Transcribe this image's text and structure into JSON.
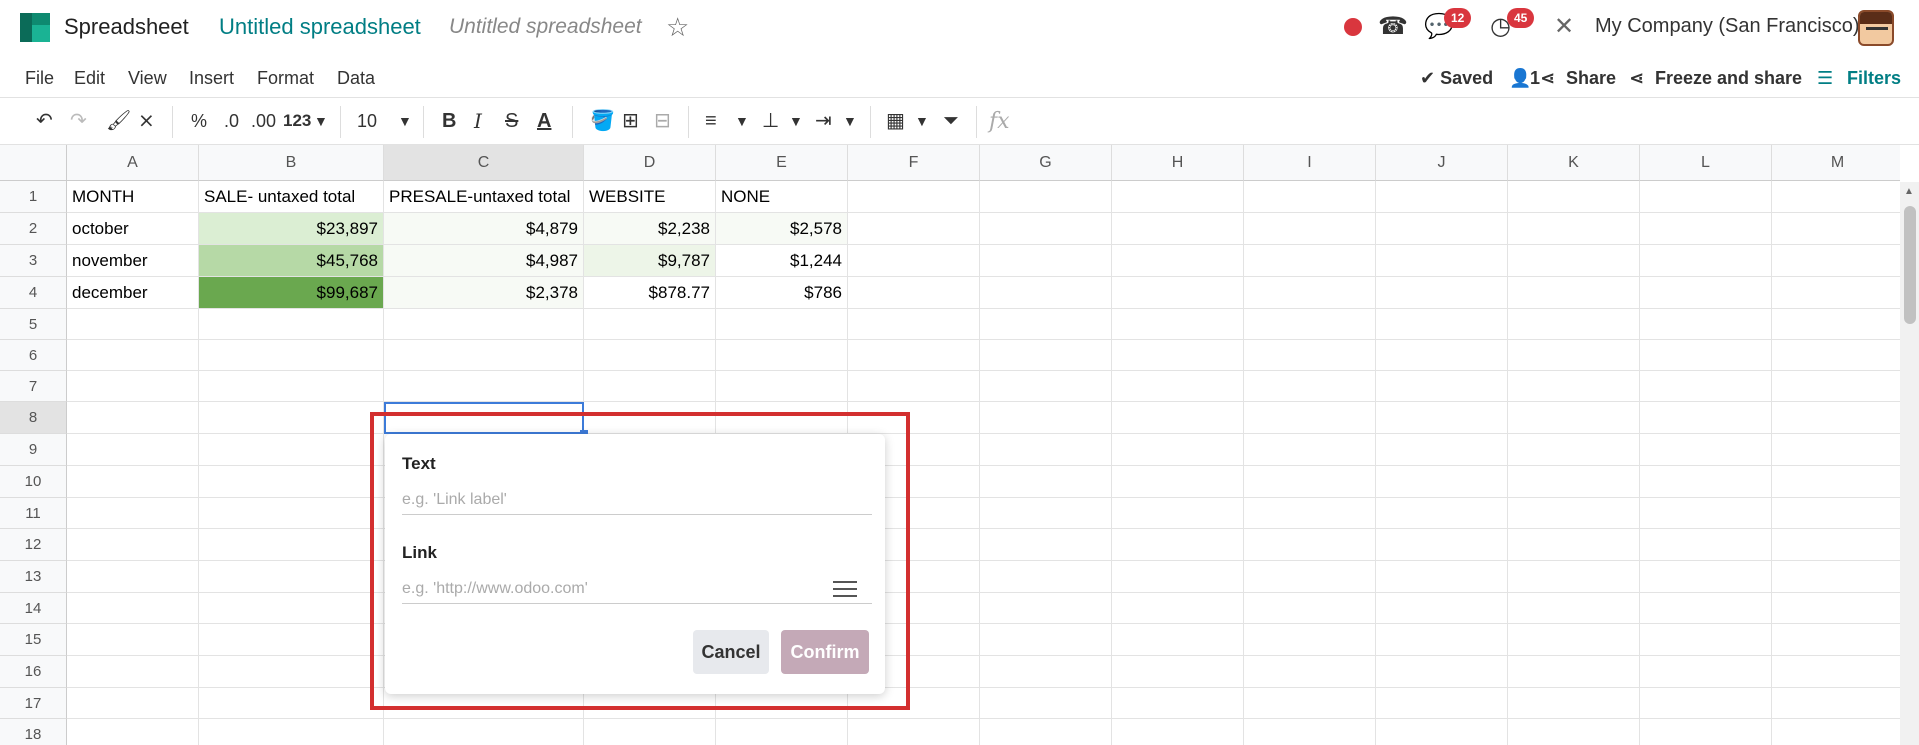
{
  "app": {
    "name": "Spreadsheet",
    "title": "Untitled spreadsheet",
    "title_placeholder": "Untitled spreadsheet",
    "star_icon": "☆",
    "company": "My Company (San Francisco)"
  },
  "systray": {
    "messages_count": "12",
    "activities_count": "45"
  },
  "menu": [
    "File",
    "Edit",
    "View",
    "Insert",
    "Format",
    "Data"
  ],
  "actions": {
    "saved": "✔ Saved",
    "users": "1",
    "share": "Share",
    "freeze_share": "Freeze and share",
    "filters": "Filters"
  },
  "toolbar": {
    "percent": "%",
    "dec_less": ".0",
    "dec_more": ".00",
    "more_formats": "123",
    "font_size": "10",
    "fx": "fx"
  },
  "columns": [
    "A",
    "B",
    "C",
    "D",
    "E",
    "F",
    "G",
    "H",
    "I",
    "J",
    "K",
    "L",
    "M"
  ],
  "rows": [
    "1",
    "2",
    "3",
    "4",
    "5",
    "6",
    "7",
    "8",
    "9",
    "10",
    "11",
    "12",
    "13",
    "14",
    "15",
    "16",
    "17",
    "18"
  ],
  "cells": {
    "A1": "MONTH",
    "B1": "SALE- untaxed total",
    "C1": "PRESALE-untaxed total",
    "D1": "WEBSITE",
    "E1": "NONE",
    "A2": "october",
    "B2": "$23,897",
    "C2": "$4,879",
    "D2": "$2,238",
    "E2": "$2,578",
    "A3": "november",
    "B3": "$45,768",
    "C3": "$4,987",
    "D3": "$9,787",
    "E3": "$1,244",
    "A4": "december",
    "B4": "$99,687",
    "C4": "$2,378",
    "D4": "$878.77",
    "E4": "$786"
  },
  "heatmap_colors": {
    "B2": "#dbeed3",
    "B3": "#b6d9a6",
    "B4": "#6aa84f",
    "C2": "#f7faf5",
    "C3": "#f7faf5",
    "C4": "#f7faf5",
    "D2": "#f7faf5",
    "D3": "#edf5e8",
    "D4": "#ffffff",
    "E2": "#f7faf5",
    "E3": "#ffffff",
    "E4": "#ffffff"
  },
  "link_dialog": {
    "text_label": "Text",
    "text_placeholder": "e.g. 'Link label'",
    "link_label": "Link",
    "link_placeholder": "e.g. 'http://www.odoo.com'",
    "cancel": "Cancel",
    "confirm": "Confirm"
  }
}
